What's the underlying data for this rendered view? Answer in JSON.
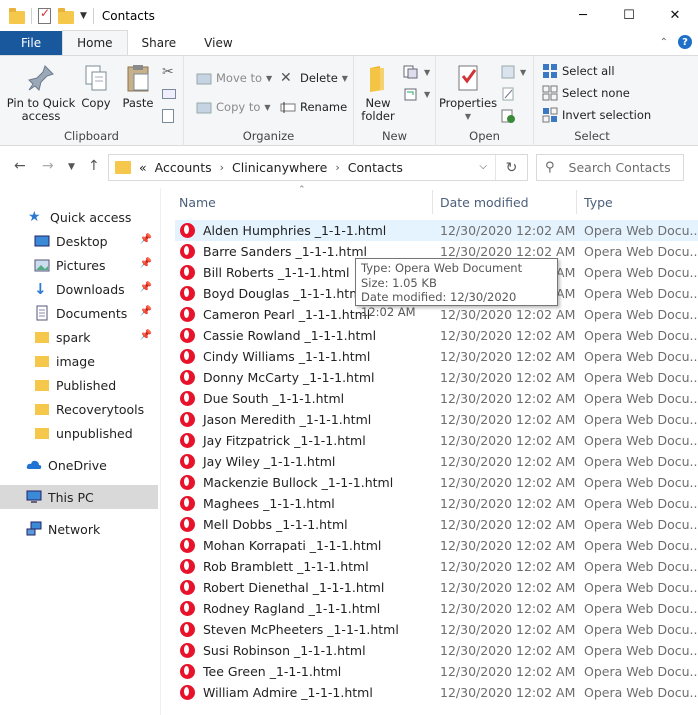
{
  "window": {
    "title": "Contacts",
    "minimize": "─",
    "maximize": "☐",
    "close": "✕"
  },
  "tabs": [
    {
      "label": "File"
    },
    {
      "label": "Home"
    },
    {
      "label": "Share"
    },
    {
      "label": "View"
    }
  ],
  "ribbon": {
    "clipboard": {
      "label": "Clipboard",
      "pin": "Pin to Quick access",
      "copy": "Copy",
      "paste": "Paste"
    },
    "organize": {
      "label": "Organize",
      "move_to": "Move to",
      "copy_to": "Copy to",
      "delete": "Delete",
      "rename": "Rename"
    },
    "new": {
      "label": "New",
      "new_folder": "New folder"
    },
    "open": {
      "label": "Open",
      "properties": "Properties"
    },
    "select": {
      "label": "Select",
      "select_all": "Select all",
      "select_none": "Select none",
      "invert": "Invert selection"
    }
  },
  "address": {
    "prefix": "«",
    "crumbs": [
      "Accounts",
      "Clinicanywhere",
      "Contacts"
    ],
    "separator": "›"
  },
  "search": {
    "placeholder": "Search Contacts"
  },
  "nav": {
    "quick_access": "Quick access",
    "items": [
      "Desktop",
      "Pictures",
      "Downloads",
      "Documents",
      "spark",
      "image",
      "Published",
      "Recoverytools",
      "unpublished"
    ],
    "onedrive": "OneDrive",
    "this_pc": "This PC",
    "network": "Network"
  },
  "columns": {
    "name": "Name",
    "date": "Date modified",
    "type": "Type"
  },
  "files": [
    {
      "name": "Alden  Humphries _1-1-1.html",
      "date": "12/30/2020 12:02 AM",
      "type": "Opera Web Docu..."
    },
    {
      "name": "Barre  Sanders _1-1-1.html",
      "date": "12/30/2020 12:02 AM",
      "type": "Opera Web Docu..."
    },
    {
      "name": "Bill  Roberts _1-1-1.html",
      "date": "12/30/2020 12:02 AM",
      "type": "Opera Web Docu..."
    },
    {
      "name": "Boyd  Douglas _1-1-1.html",
      "date": "12/30/2020 12:02 AM",
      "type": "Opera Web Docu..."
    },
    {
      "name": "Cameron  Pearl _1-1-1.html",
      "date": "12/30/2020 12:02 AM",
      "type": "Opera Web Docu..."
    },
    {
      "name": "Cassie  Rowland _1-1-1.html",
      "date": "12/30/2020 12:02 AM",
      "type": "Opera Web Docu..."
    },
    {
      "name": "Cindy  Williams _1-1-1.html",
      "date": "12/30/2020 12:02 AM",
      "type": "Opera Web Docu..."
    },
    {
      "name": "Donny  McCarty _1-1-1.html",
      "date": "12/30/2020 12:02 AM",
      "type": "Opera Web Docu..."
    },
    {
      "name": "Due South  _1-1-1.html",
      "date": "12/30/2020 12:02 AM",
      "type": "Opera Web Docu..."
    },
    {
      "name": "Jason  Meredith _1-1-1.html",
      "date": "12/30/2020 12:02 AM",
      "type": "Opera Web Docu..."
    },
    {
      "name": "Jay  Fitzpatrick _1-1-1.html",
      "date": "12/30/2020 12:02 AM",
      "type": "Opera Web Docu..."
    },
    {
      "name": "Jay  Wiley _1-1-1.html",
      "date": "12/30/2020 12:02 AM",
      "type": "Opera Web Docu..."
    },
    {
      "name": "Mackenzie  Bullock _1-1-1.html",
      "date": "12/30/2020 12:02 AM",
      "type": "Opera Web Docu..."
    },
    {
      "name": "Maghees  _1-1-1.html",
      "date": "12/30/2020 12:02 AM",
      "type": "Opera Web Docu..."
    },
    {
      "name": "Mell  Dobbs _1-1-1.html",
      "date": "12/30/2020 12:02 AM",
      "type": "Opera Web Docu..."
    },
    {
      "name": "Mohan  Korrapati _1-1-1.html",
      "date": "12/30/2020 12:02 AM",
      "type": "Opera Web Docu..."
    },
    {
      "name": "Rob  Bramblett _1-1-1.html",
      "date": "12/30/2020 12:02 AM",
      "type": "Opera Web Docu..."
    },
    {
      "name": "Robert  Dienethal _1-1-1.html",
      "date": "12/30/2020 12:02 AM",
      "type": "Opera Web Docu..."
    },
    {
      "name": "Rodney  Ragland _1-1-1.html",
      "date": "12/30/2020 12:02 AM",
      "type": "Opera Web Docu..."
    },
    {
      "name": "Steven  McPheeters _1-1-1.html",
      "date": "12/30/2020 12:02 AM",
      "type": "Opera Web Docu..."
    },
    {
      "name": "Susi  Robinson _1-1-1.html",
      "date": "12/30/2020 12:02 AM",
      "type": "Opera Web Docu..."
    },
    {
      "name": "Tee  Green _1-1-1.html",
      "date": "12/30/2020 12:02 AM",
      "type": "Opera Web Docu..."
    },
    {
      "name": "William  Admire _1-1-1.html",
      "date": "12/30/2020 12:02 AM",
      "type": "Opera Web Docu..."
    }
  ],
  "tooltip": {
    "line1": "Type: Opera Web Document",
    "line2": "Size: 1.05 KB",
    "line3": "Date modified: 12/30/2020 12:02 AM"
  },
  "colors": {
    "file_tab": "#19589c",
    "hover_row": "#e5f3ff",
    "opera_red": "#e8132b",
    "folder": "#f5c84c"
  }
}
